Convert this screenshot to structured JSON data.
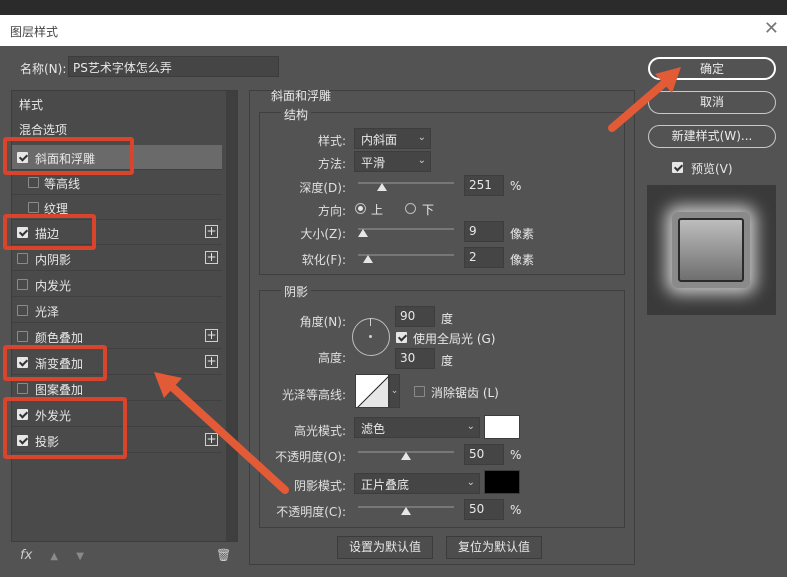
{
  "window": {
    "title": "图层样式",
    "close_glyph": "✕"
  },
  "name_field": {
    "label": "名称(N):",
    "value": "PS艺术字体怎么弄"
  },
  "styles_list": {
    "header": "样式",
    "blend_options": "混合选项",
    "items": [
      {
        "label": "斜面和浮雕",
        "checked": true,
        "selected": true,
        "has_add": false
      },
      {
        "label": "等高线",
        "checked": false,
        "sub": true,
        "has_add": false
      },
      {
        "label": "纹理",
        "checked": false,
        "sub": true,
        "has_add": false
      },
      {
        "label": "描边",
        "checked": true,
        "has_add": true
      },
      {
        "label": "内阴影",
        "checked": false,
        "has_add": true
      },
      {
        "label": "内发光",
        "checked": false,
        "has_add": false
      },
      {
        "label": "光泽",
        "checked": false,
        "has_add": false
      },
      {
        "label": "颜色叠加",
        "checked": false,
        "has_add": true
      },
      {
        "label": "渐变叠加",
        "checked": true,
        "has_add": true
      },
      {
        "label": "图案叠加",
        "checked": false,
        "has_add": false
      },
      {
        "label": "外发光",
        "checked": true,
        "has_add": false
      },
      {
        "label": "投影",
        "checked": true,
        "has_add": true
      }
    ],
    "bottom_icons": {
      "fx": "fx",
      "up": "▲",
      "down": "▼",
      "trash": "🗑"
    }
  },
  "bevel": {
    "section_title": "斜面和浮雕",
    "structure_title": "结构",
    "style_label": "样式:",
    "style_value": "内斜面",
    "method_label": "方法:",
    "method_value": "平滑",
    "depth_label": "深度(D):",
    "depth_value": "251",
    "depth_unit": "%",
    "depth_level": 0.25,
    "direction_label": "方向:",
    "dir_up": "上",
    "dir_down": "下",
    "size_label": "大小(Z):",
    "size_value": "9",
    "size_unit": "像素",
    "size_level": 0.05,
    "soften_label": "软化(F):",
    "soften_value": "2",
    "soften_unit": "像素",
    "soften_level": 0.1
  },
  "shading": {
    "title": "阴影",
    "angle_label": "角度(N):",
    "angle_value": "90",
    "angle_unit": "度",
    "global_light": "使用全局光 (G)",
    "altitude_label": "高度:",
    "altitude_value": "30",
    "altitude_unit": "度",
    "gloss_label": "光泽等高线:",
    "antialias": "消除锯齿 (L)",
    "highlight_mode_label": "高光模式:",
    "highlight_mode_value": "滤色",
    "highlight_color": "#ffffff",
    "highlight_opacity_label": "不透明度(O):",
    "highlight_opacity_value": "50",
    "highlight_opacity_unit": "%",
    "highlight_opacity_level": 0.5,
    "shadow_mode_label": "阴影模式:",
    "shadow_mode_value": "正片叠底",
    "shadow_color": "#000000",
    "shadow_opacity_label": "不透明度(C):",
    "shadow_opacity_value": "50",
    "shadow_opacity_unit": "%",
    "shadow_opacity_level": 0.5
  },
  "buttons": {
    "set_default": "设置为默认值",
    "reset_default": "复位为默认值",
    "ok": "确定",
    "cancel": "取消",
    "new_style": "新建样式(W)...",
    "preview": "预览(V)"
  },
  "annotation_color": "#d9442c"
}
